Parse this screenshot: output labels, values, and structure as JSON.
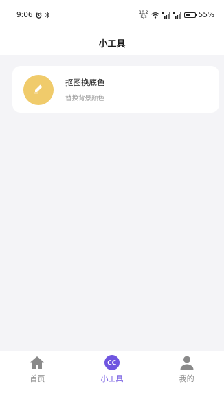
{
  "status_bar": {
    "time": "9:06",
    "net_speed_top": "10.2",
    "net_speed_bottom": "K/s",
    "battery_percent": "55%",
    "battery_level": 0.55
  },
  "header": {
    "title": "小工具"
  },
  "tools": [
    {
      "title": "抠图换底色",
      "subtitle": "替换背景颜色",
      "icon": "pencil-icon",
      "icon_color": "#f0cb6b"
    }
  ],
  "tab_bar": {
    "active_color": "#6f55e0",
    "inactive_color": "#8a8a8a",
    "tabs": [
      {
        "label": "首页",
        "icon": "home-icon",
        "active": false
      },
      {
        "label": "小工具",
        "icon": "cc-icon",
        "active": true
      },
      {
        "label": "我的",
        "icon": "user-icon",
        "active": false
      }
    ]
  }
}
